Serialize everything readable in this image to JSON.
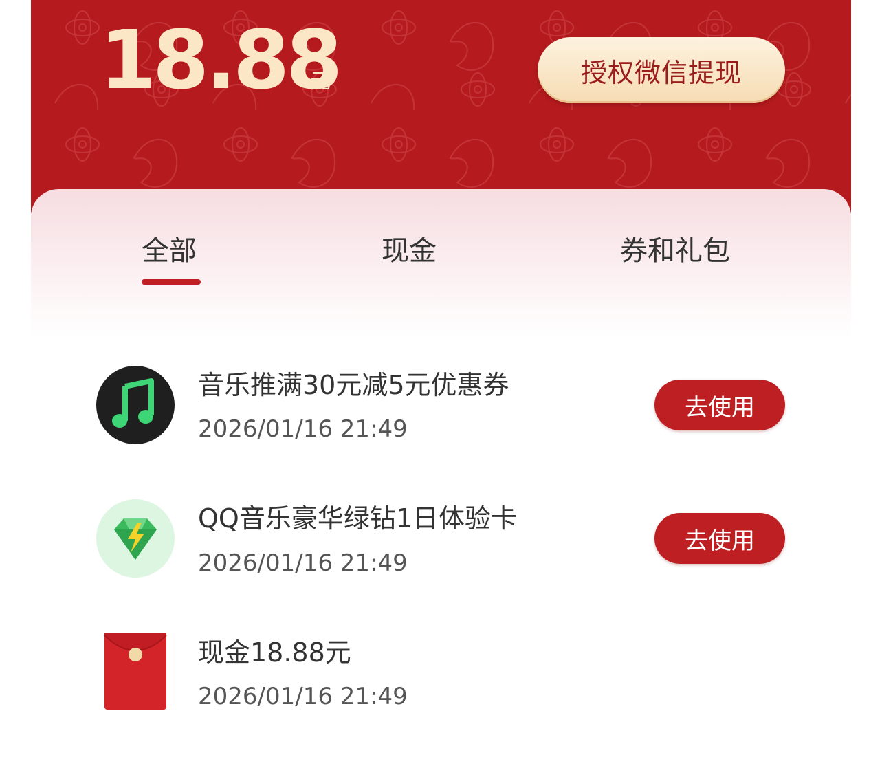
{
  "balance": {
    "amount": "18.88",
    "unit": "元"
  },
  "withdraw_button": {
    "label": "授权微信提现"
  },
  "tabs": [
    {
      "label": "全部",
      "selected": true
    },
    {
      "label": "现金",
      "selected": false
    },
    {
      "label": "券和礼包",
      "selected": false
    }
  ],
  "items": [
    {
      "icon": "music-note-icon",
      "title": "音乐推满30元减5元优惠券",
      "time": "2026/01/16 21:49",
      "action": "去使用"
    },
    {
      "icon": "green-diamond-icon",
      "title": "QQ音乐豪华绿钻1日体验卡",
      "time": "2026/01/16 21:49",
      "action": "去使用"
    },
    {
      "icon": "red-envelope-icon",
      "title": "现金18.88元",
      "time": "2026/01/16 21:49"
    }
  ],
  "colors": {
    "header_red": "#b51b1e",
    "amount_gold": "#fbe7c6",
    "button_red": "#bd1f22",
    "tab_indicator": "#c21f24",
    "text_dark": "#333333"
  }
}
